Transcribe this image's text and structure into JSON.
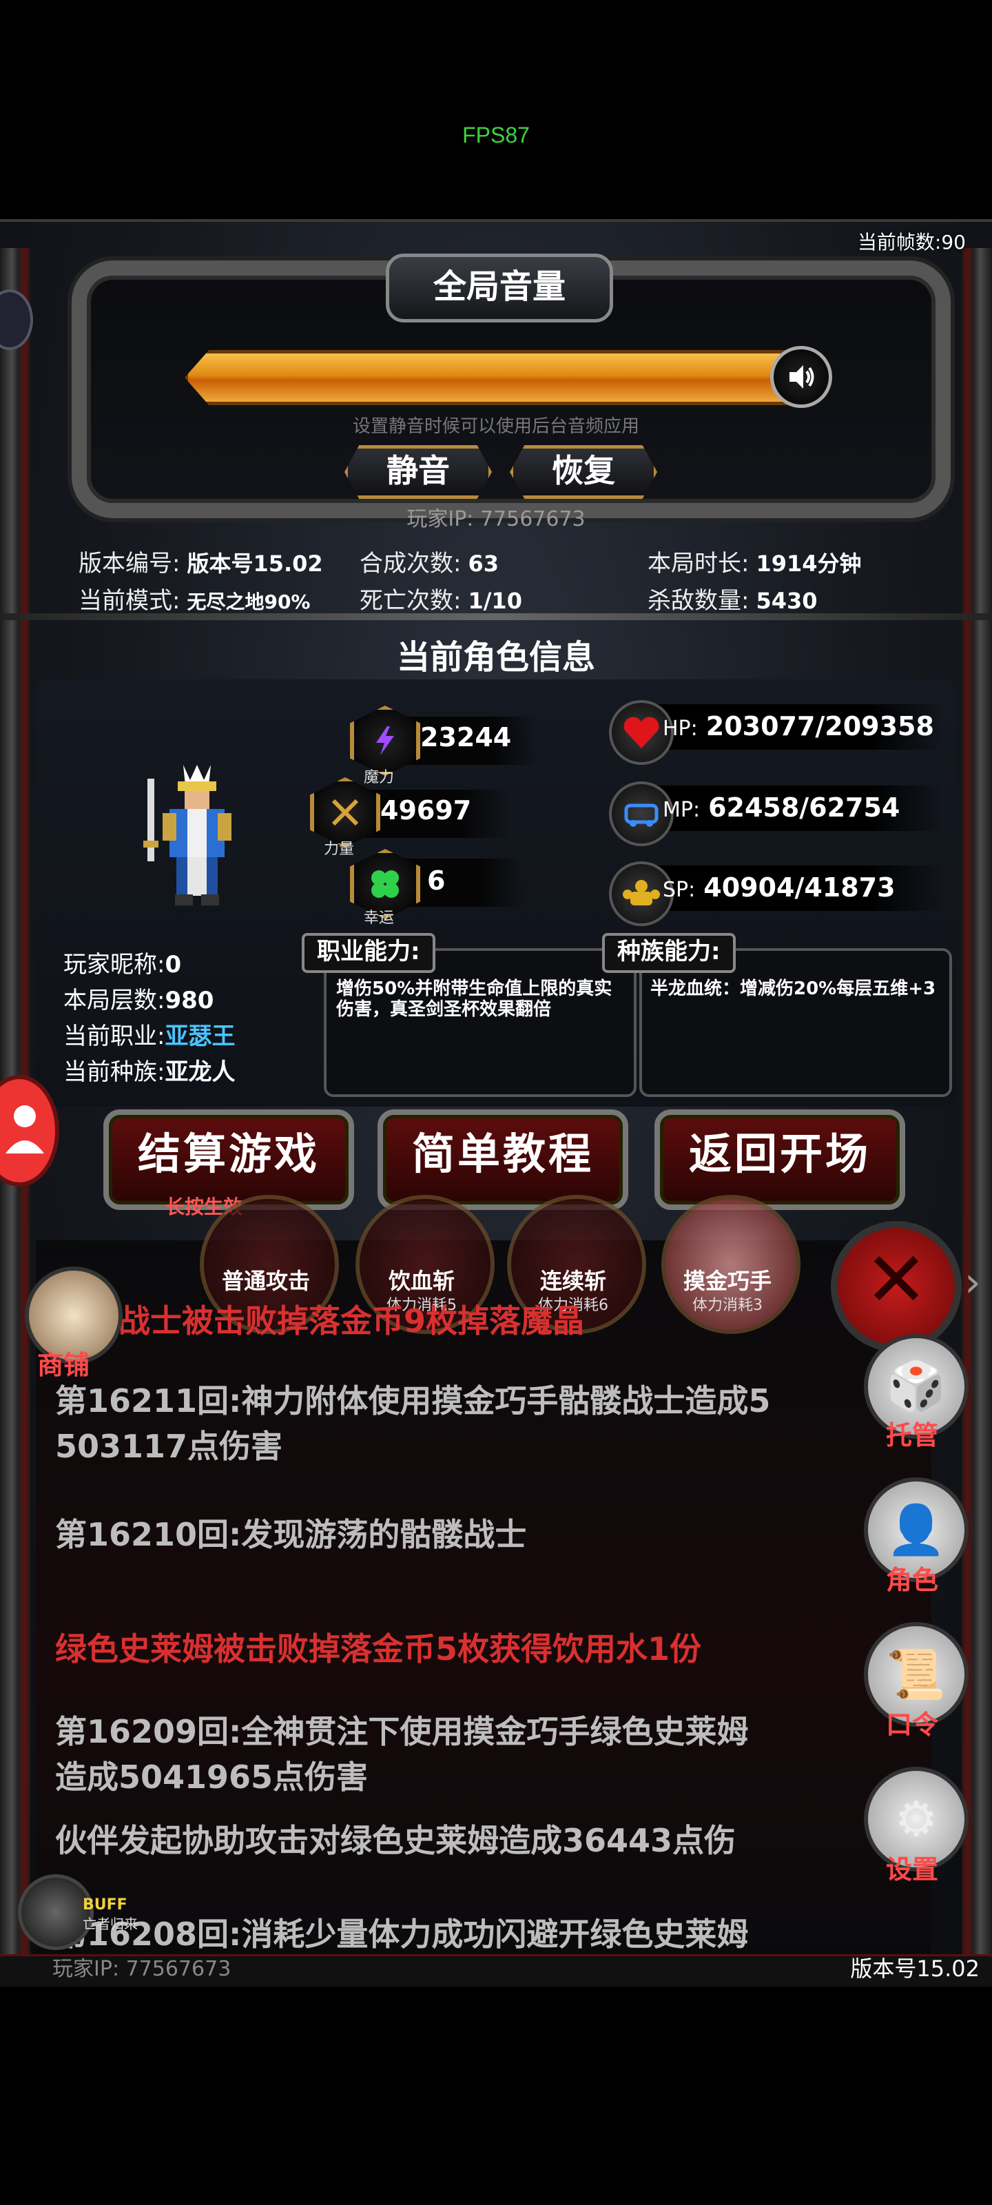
{
  "fps_overlay": "FPS87",
  "frame_count": "当前帧数:90",
  "volume": {
    "title": "全局音量",
    "level": 1.0,
    "hint": "设置静音时候可以使用后台音频应用",
    "mute_label": "静音",
    "restore_label": "恢复",
    "speaker_icon": "speaker-icon"
  },
  "player_ip": "玩家IP:  77567673",
  "stats": {
    "version_label": "版本编号:",
    "version_value": "版本号15.02",
    "mode_label": "当前模式:",
    "mode_value": "无尽之地90%",
    "merge_label": "合成次数:",
    "merge_value": "63",
    "death_label": "死亡次数:",
    "death_value": "1/10",
    "duration_label": "本局时长:",
    "duration_value": "1914分钟",
    "kills_label": "杀敌数量:",
    "kills_value": "5430"
  },
  "character": {
    "section_title": "当前角色信息",
    "magic_value": "23244",
    "magic_caption": "魔力",
    "power_value": "49697",
    "power_caption": "力量",
    "luck_value": "6",
    "luck_caption": "幸运",
    "hp_label": "HP:",
    "hp_value": "203077/209358",
    "mp_label": "MP:",
    "mp_value": "62458/62754",
    "sp_label": "SP:",
    "sp_value": "40904/41873",
    "nickname_label": "玩家昵称:",
    "nickname_value": "0",
    "floor_label": "本局层数:",
    "floor_value": "980",
    "class_label": "当前职业:",
    "class_value": "亚瑟王",
    "race_label": "当前种族:",
    "race_value": "亚龙人",
    "class_ability_tag": "职业能力:",
    "class_ability_text": "增伤50%并附带生命值上限的真实伤害，真圣剑圣杯效果翻倍",
    "race_ability_tag": "种族能力:",
    "race_ability_text": "半龙血统：增减伤20%每层五维+3"
  },
  "buttons": {
    "settle": "结算游戏",
    "settle_sub": "长按生效",
    "tutorial": "简单教程",
    "back": "返回开场"
  },
  "skills": [
    {
      "label": "普通攻击",
      "sub": ""
    },
    {
      "label": "饮血斩",
      "sub": "体力消耗5"
    },
    {
      "label": "连续斩",
      "sub": "体力消耗6"
    },
    {
      "label": "摸金巧手",
      "sub": "体力消耗3"
    }
  ],
  "shop_label": "商铺",
  "log": [
    {
      "text": "骷髅战士被击败掉落金币9枚掉落魔晶",
      "style": "red"
    },
    {
      "text": "第16211回:神力附体使用摸金巧手骷髅战士造成5",
      "style": "gray"
    },
    {
      "text": "503117点伤害",
      "style": "gray"
    },
    {
      "text": "第16210回:发现游荡的骷髅战士",
      "style": "gray"
    },
    {
      "text": "绿色史莱姆被击败掉落金币5枚获得饮用水1份",
      "style": "red"
    },
    {
      "text": "第16209回:全神贯注下使用摸金巧手绿色史莱姆",
      "style": "gray"
    },
    {
      "text": "造成5041965点伤害",
      "style": "gray"
    },
    {
      "text": "伙伴发起协助攻击对绿色史莱姆造成36443点伤",
      "style": "gray"
    },
    {
      "text": "第16208回:消耗少量体力成功闪避开绿色史莱姆",
      "style": "gray"
    }
  ],
  "side_menu": {
    "auto": "托管",
    "role": "角色",
    "code": "口令",
    "settings": "设置"
  },
  "buff": {
    "title": "BUFF",
    "sub": "亡者归来"
  },
  "footer": {
    "ip": "玩家IP:  77567673",
    "version": "版本号15.02"
  }
}
